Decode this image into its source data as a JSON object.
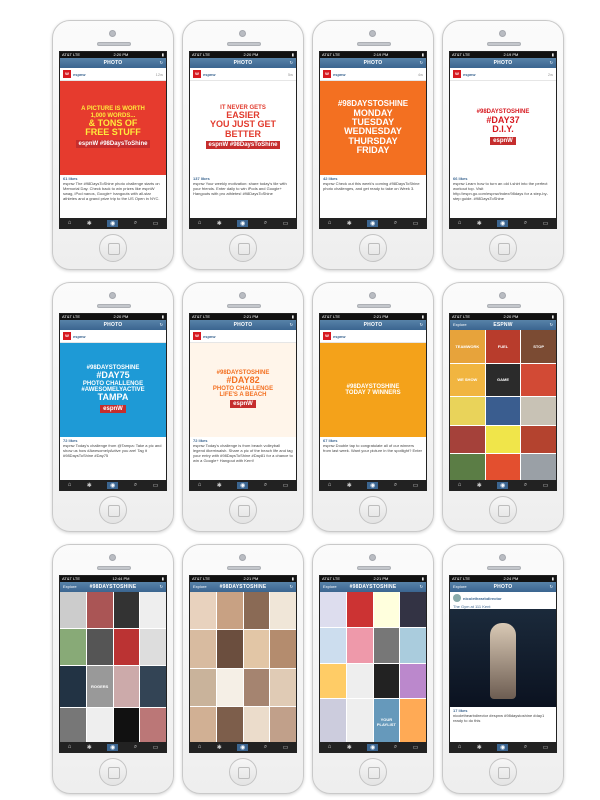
{
  "phones": [
    {
      "status": "AT&T LTE",
      "clock": "2:20 PM",
      "nav": "PHOTO",
      "user": "espnw",
      "age": "12w",
      "post": [
        "A PICTURE IS WORTH",
        "1,000 WORDS...",
        "& TONS OF",
        "FREE STUFF"
      ],
      "badge": "espnW #98DaysToShine",
      "likes": "61 likes",
      "caption": "espnw The #98DaysToShine photo challenge starts on Memorial Day. Check back to win prizes like espnW swag, iPod nanos, Google+ hangouts with all-star athletes and a grand prize trip to the US Open in NYC."
    },
    {
      "status": "AT&T LTE",
      "clock": "2:20 PM",
      "nav": "PHOTO",
      "user": "espnw",
      "age": "5w",
      "post": [
        "IT NEVER GETS",
        "EASIER",
        "YOU JUST GET",
        "BETTER"
      ],
      "badge": "espnW #98DaysToShine",
      "likes": "137 likes",
      "caption": "espnw Your weekly motivation: share today's tile with your friends. Enter daily to win iPods and Google+ Hangouts with pro athletes! #98DaysToShine"
    },
    {
      "status": "AT&T LTE",
      "clock": "2:19 PM",
      "nav": "PHOTO",
      "user": "espnw",
      "age": "4w",
      "post": [
        "#98DaysToShine",
        "Monday",
        "Tuesday",
        "Wednesday",
        "Thursday",
        "Friday"
      ],
      "badge": "",
      "likes": "42 likes",
      "caption": "espnw Check out this week's coming #98DaysToShine photo challenges, and get ready to take on Week 3."
    },
    {
      "status": "AT&T LTE",
      "clock": "2:19 PM",
      "nav": "PHOTO",
      "user": "espnw",
      "age": "2w",
      "post": [
        "#98DaysToShine",
        "#day37",
        "D.I.Y."
      ],
      "badge": "espnW",
      "likes": "66 likes",
      "caption": "espnw Learn how to turn an old t-shirt into the perfect workout top. Visit http://espn.go.com/espnw/index/98days for a step-by-step guide. #98DaysToShine"
    },
    {
      "status": "AT&T LTE",
      "clock": "2:20 PM",
      "nav": "PHOTO",
      "user": "espnw",
      "age": "",
      "post": [
        "#98DaysToShine",
        "#day75",
        "PHOTO CHALLENGE",
        "#AWESOMELYACTIVE",
        "TAMPA"
      ],
      "badge": "espnW",
      "likes": "72 likes",
      "caption": "espnw Today's challenge from @Tampa: Take a pic and show us how #AwesomelyActive you are! Tag it #98DaysToShine #Day75"
    },
    {
      "status": "AT&T LTE",
      "clock": "2:21 PM",
      "nav": "PHOTO",
      "user": "espnw",
      "age": "",
      "post": [
        "#98DaysToShine",
        "#day82",
        "PHOTO CHALLENGE",
        "LIFE'S A BEACH"
      ],
      "badge": "espnW",
      "likes": "72 likes",
      "caption": "espnw Today's challenge is from beach volleyball legend #kerriwalsh. Share a pic of the beach life and tag your entry with #98DaysToShine #Day81 for a chance to win a Google+ Hangout with Kerri!"
    },
    {
      "status": "AT&T LTE",
      "clock": "2:21 PM",
      "nav": "PHOTO",
      "user": "espnw",
      "age": "",
      "post": [
        "#98DaysToShine",
        "TODAY 7 WINNERS"
      ],
      "badge": "",
      "likes": "67 likes",
      "caption": "espnw Double tap to congratulate all of our winners from last week. Want your picture in the spotlight? Enter"
    },
    {
      "status": "AT&T LTE",
      "clock": "2:20 PM",
      "nav": "ESPNW",
      "user": "",
      "age": "",
      "post": [
        "TEAMWORK",
        "FUEL",
        "STOP",
        "WE SHOW",
        "GAME"
      ],
      "badge": "",
      "likes": "",
      "caption": ""
    },
    {
      "status": "AT&T LTE",
      "clock": "12:44 PM",
      "nav": "#98DAYSTOSHINE",
      "user": "",
      "age": "",
      "post": [
        "ROGERS"
      ],
      "badge": "",
      "likes": "",
      "caption": ""
    },
    {
      "status": "AT&T LTE",
      "clock": "2:21 PM",
      "nav": "#98DAYSTOSHINE",
      "user": "",
      "age": "",
      "post": [],
      "badge": "",
      "likes": "",
      "caption": ""
    },
    {
      "status": "AT&T LTE",
      "clock": "2:21 PM",
      "nav": "#98DAYSTOSHINE",
      "user": "",
      "age": "",
      "post": [
        "YOUR PLAYLIST"
      ],
      "badge": "",
      "likes": "",
      "caption": ""
    },
    {
      "status": "AT&T LTE",
      "clock": "2:24 PM",
      "nav": "PHOTO",
      "user": "nicolethearbdirector",
      "age": "",
      "post": [
        "The Gym at 111 Kent"
      ],
      "badge": "",
      "likes": "17 likes",
      "caption": "nicolethearbdirector #espnw #98daystoshine #day1 ready to do this"
    }
  ],
  "nav_left_explore": "Explore",
  "colors": {
    "insta_blue": "#3b6590",
    "espn_red": "#d71920",
    "orange": "#f37021"
  }
}
